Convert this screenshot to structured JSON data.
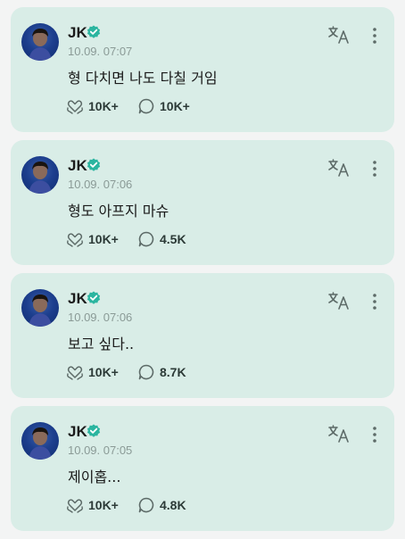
{
  "colors": {
    "card_bg": "#d9ede7",
    "verified": "#2bb5a0",
    "icon": "#5d6b68"
  },
  "icons": {
    "verified": "verified-badge-icon",
    "translate": "translate-icon",
    "more": "more-vertical-icon",
    "likes": "heart-hands-icon",
    "comments": "speech-bubble-icon"
  },
  "posts": [
    {
      "author": "JK",
      "timestamp": "10.09. 07:07",
      "text": "형 다치면 나도 다칠 거임",
      "likes": "10K+",
      "comments": "10K+"
    },
    {
      "author": "JK",
      "timestamp": "10.09. 07:06",
      "text": "형도 아프지 마슈",
      "likes": "10K+",
      "comments": "4.5K"
    },
    {
      "author": "JK",
      "timestamp": "10.09. 07:06",
      "text": "보고 싶다..",
      "likes": "10K+",
      "comments": "8.7K"
    },
    {
      "author": "JK",
      "timestamp": "10.09. 07:05",
      "text": "제이홉...",
      "likes": "10K+",
      "comments": "4.8K"
    }
  ]
}
